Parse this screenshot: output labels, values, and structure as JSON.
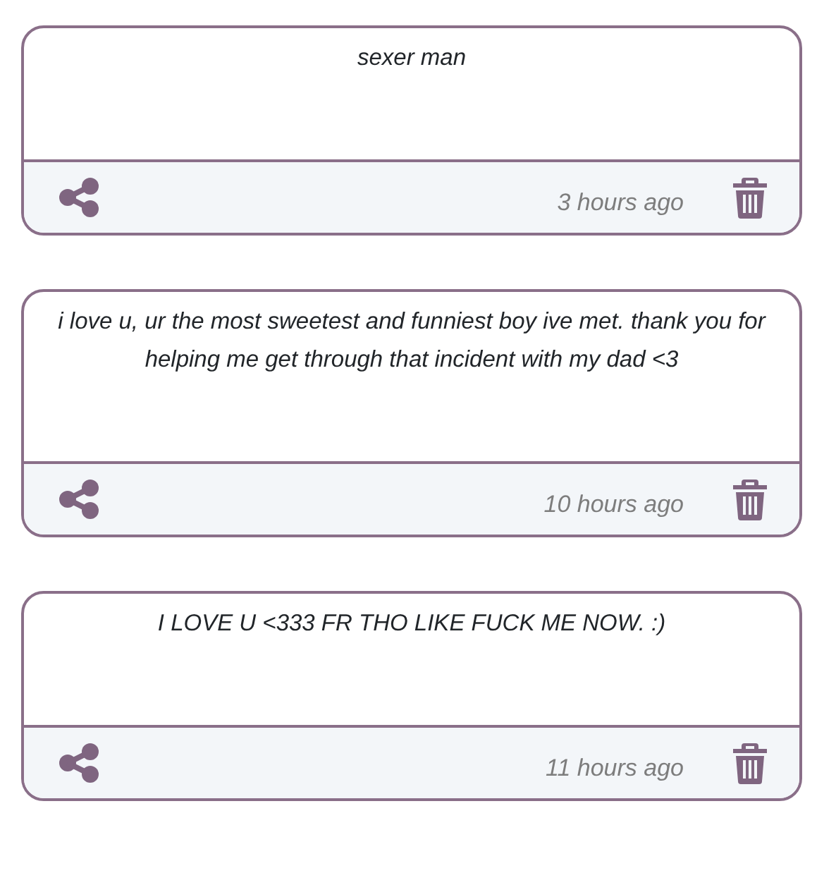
{
  "messages": [
    {
      "text": "sexer man",
      "time": "3 hours ago"
    },
    {
      "text": "i love u, ur the most sweetest and funniest boy ive met. thank you for helping me get through that incident with my dad <3",
      "time": "10 hours ago"
    },
    {
      "text": "I LOVE U <333 FR THO LIKE FUCK ME NOW. :)",
      "time": "11 hours ago"
    }
  ]
}
